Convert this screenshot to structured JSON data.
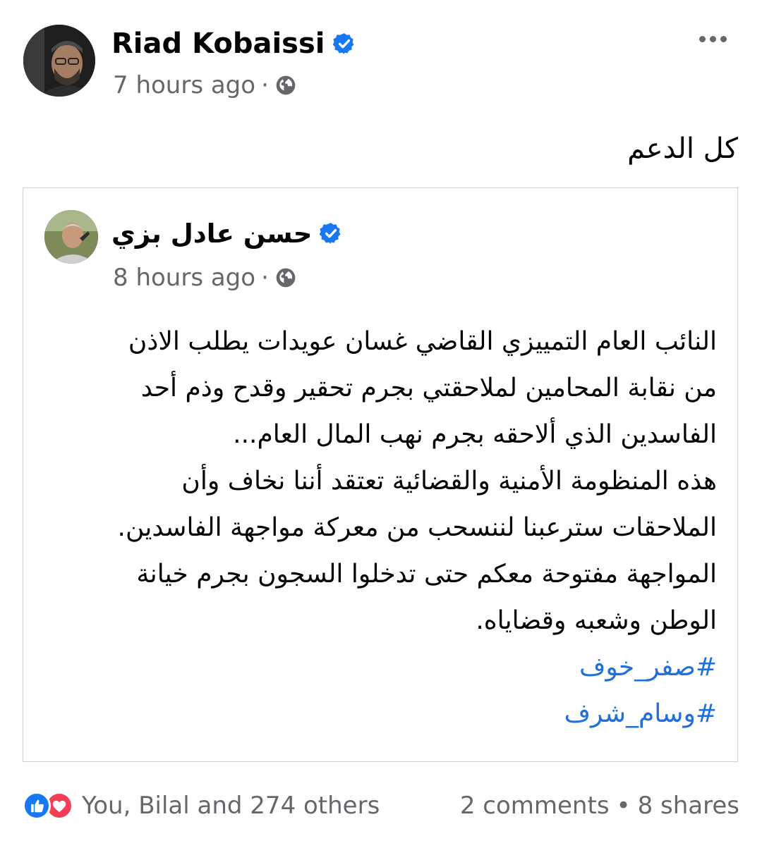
{
  "post": {
    "author": "Riad Kobaissi",
    "time": "7 hours ago",
    "separator": "·",
    "caption": "كل الدعم"
  },
  "shared": {
    "author": "حسن عادل بزي",
    "time": "8 hours ago",
    "separator": "·",
    "lines": [
      "النائب العام التمييزي القاضي غسان عويدات يطلب الاذن",
      "من نقابة المحامين لملاحقتي بجرم تحقير وقدح وذم أحد",
      "الفاسدين الذي ألاحقه بجرم نهب المال العام...",
      "هذه المنظومة الأمنية والقضائية تعتقد أننا نخاف وأن",
      "الملاحقات سترعبنا لننسحب من معركة مواجهة الفاسدين.",
      "المواجهة مفتوحة معكم حتى تدخلوا السجون بجرم خيانة",
      "الوطن وشعبه وقضاياه."
    ],
    "hashtags": [
      "#صفر_خوف",
      "#وسام_شرف"
    ]
  },
  "footer": {
    "reactions_text": "You, Bilal and 274 others",
    "comments": "2 comments",
    "bullet": "•",
    "shares": "8 shares"
  },
  "icons": {
    "verified": "verified-badge-icon",
    "privacy": "globe-icon",
    "more": "more-options-icon",
    "like": "like-reaction-icon",
    "love": "love-reaction-icon"
  },
  "colors": {
    "verified_blue": "#1877f2",
    "hashtag_blue": "#216fdb",
    "secondary_text": "#65676b",
    "love_red": "#f33e58"
  }
}
